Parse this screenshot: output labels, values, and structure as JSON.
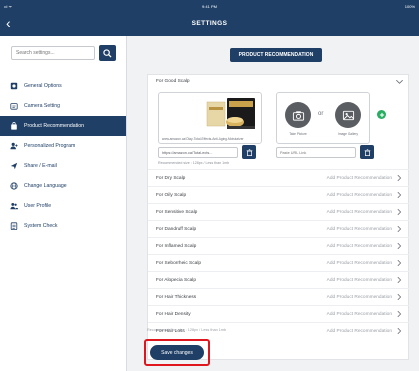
{
  "status_bar": {
    "signal": "•ıl ᯤ",
    "time": "9:41 PM",
    "battery": "100%"
  },
  "header": {
    "back_glyph": "‹",
    "title": "SETTINGS"
  },
  "sidebar": {
    "search_placeholder": "Search settings...",
    "items": [
      {
        "label": "General Options",
        "icon": "gear-icon",
        "active": false
      },
      {
        "label": "Camera Setting",
        "icon": "camera-icon",
        "active": false
      },
      {
        "label": "Product Recommendation",
        "icon": "bag-icon",
        "active": true
      },
      {
        "label": "Personalized Program",
        "icon": "user-plus-icon",
        "active": false
      },
      {
        "label": "Share / E-mail",
        "icon": "send-icon",
        "active": false
      },
      {
        "label": "Change Language",
        "icon": "globe-icon",
        "active": false
      },
      {
        "label": "User Profile",
        "icon": "users-icon",
        "active": false
      },
      {
        "label": "System Check",
        "icon": "checklist-icon",
        "active": false
      }
    ]
  },
  "main": {
    "product_recommendation_button": "PRODUCT RECOMMENDATION",
    "good_scalp": {
      "label": "For Good Scalp",
      "product_url_small": "www.amazon.ca/Olay-Total-Effects-Anti-Aging-Moisturizer",
      "url_value": "https://amazon.ca/Total-ects...",
      "recommended_size": "Recommended size : 128px / Less than 1mb",
      "take_picture_label": "Take Picture",
      "or_label": "or",
      "image_gallery_label": "Image Gallery",
      "paste_url_placeholder": "Paste URL Link"
    },
    "scalp_rows": [
      {
        "name": "For Dry Scalp",
        "action": "Add Product Recommendation"
      },
      {
        "name": "For Oily Scalp",
        "action": "Add Product Recommendation"
      },
      {
        "name": "For Sensitive Scalp",
        "action": "Add Product Recommendation"
      },
      {
        "name": "For Dandruff Scalp",
        "action": "Add Product Recommendation"
      },
      {
        "name": "For Inflamed Scalp",
        "action": "Add Product Recommendation"
      },
      {
        "name": "For Seborrheic Scalp",
        "action": "Add Product Recommendation"
      },
      {
        "name": "For Alopecia Scalp",
        "action": "Add Product Recommendation"
      },
      {
        "name": "For Hair Thickness",
        "action": "Add Product Recommendation"
      },
      {
        "name": "For Hair Density",
        "action": "Add Product Recommendation"
      },
      {
        "name": "For Hair Loss",
        "action": "Add Product Recommendation"
      }
    ],
    "bottom_note": "Recommendation size : 128px / Less than 1mb",
    "save_button": "Save changes"
  },
  "colors": {
    "primary": "#1f3f66",
    "highlight": "#e0161e",
    "add": "#27ae60"
  }
}
